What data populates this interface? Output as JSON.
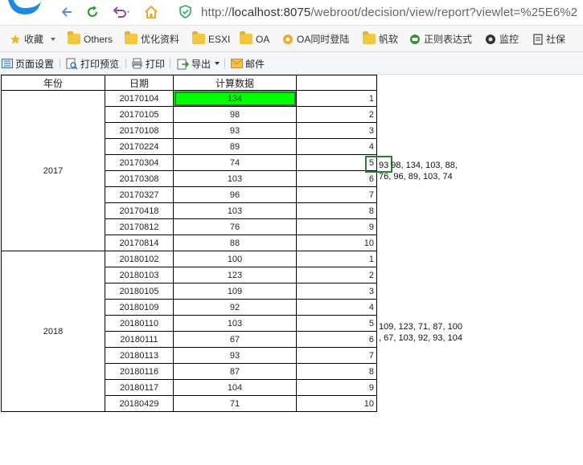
{
  "browser": {
    "url_prefix": "http://",
    "url_host": "localhost:8075",
    "url_rest": "/webroot/decision/view/report?viewlet=%25E6%2"
  },
  "bookmarks": [
    {
      "label": "收藏",
      "icon": "star-icon",
      "dropdown": true
    },
    {
      "label": "Others",
      "icon": "folder-icon"
    },
    {
      "label": "优化资料",
      "icon": "folder-icon"
    },
    {
      "label": "ESXI",
      "icon": "folder-icon"
    },
    {
      "label": "OA",
      "icon": "folder-icon"
    },
    {
      "label": "OA同时登陆",
      "icon": "oa-app-icon"
    },
    {
      "label": "帆软",
      "icon": "folder-icon"
    },
    {
      "label": "正则表达式",
      "icon": "regex-site-icon"
    },
    {
      "label": "监控",
      "icon": "camera-icon"
    },
    {
      "label": "社保",
      "icon": "doc-icon"
    }
  ],
  "toolbar": {
    "page_setup": "页面设置",
    "print_preview": "打印预览",
    "print": "打印",
    "export": "导出",
    "mail": "邮件"
  },
  "table": {
    "headers": [
      "年份",
      "日期",
      "计算数据",
      ""
    ],
    "groups": [
      {
        "year": "2017",
        "rows": [
          {
            "date": "20170104",
            "value": "134",
            "index": "1"
          },
          {
            "date": "20170105",
            "value": "98",
            "index": "2"
          },
          {
            "date": "20170108",
            "value": "93",
            "index": "3"
          },
          {
            "date": "20170224",
            "value": "89",
            "index": "4"
          },
          {
            "date": "20170304",
            "value": "74",
            "index": "5"
          },
          {
            "date": "20170308",
            "value": "103",
            "index": "6"
          },
          {
            "date": "20170327",
            "value": "96",
            "index": "7"
          },
          {
            "date": "20170418",
            "value": "103",
            "index": "8"
          },
          {
            "date": "20170812",
            "value": "76",
            "index": "9"
          },
          {
            "date": "20170814",
            "value": "88",
            "index": "10"
          }
        ]
      },
      {
        "year": "2018",
        "rows": [
          {
            "date": "20180102",
            "value": "100",
            "index": "1"
          },
          {
            "date": "20180103",
            "value": "123",
            "index": "2"
          },
          {
            "date": "20180105",
            "value": "109",
            "index": "3"
          },
          {
            "date": "20180109",
            "value": "92",
            "index": "4"
          },
          {
            "date": "20180110",
            "value": "103",
            "index": "5"
          },
          {
            "date": "20180111",
            "value": "67",
            "index": "6"
          },
          {
            "date": "20180113",
            "value": "93",
            "index": "7"
          },
          {
            "date": "20180116",
            "value": "87",
            "index": "8"
          },
          {
            "date": "20180117",
            "value": "104",
            "index": "9"
          },
          {
            "date": "20180429",
            "value": "71",
            "index": "10"
          }
        ]
      }
    ]
  },
  "annotations": {
    "y2017_boxed": "93",
    "y2017_line1": " 98, 134, 103, 88,",
    "y2017_line2": "76, 96, 89, 103, 74",
    "y2018_line1": "109, 123, 71, 87, 100",
    "y2018_line2": ", 67, 103, 92, 93, 104"
  },
  "colors": {
    "highlight": "#00ff00",
    "selection": "#2e7d32"
  }
}
